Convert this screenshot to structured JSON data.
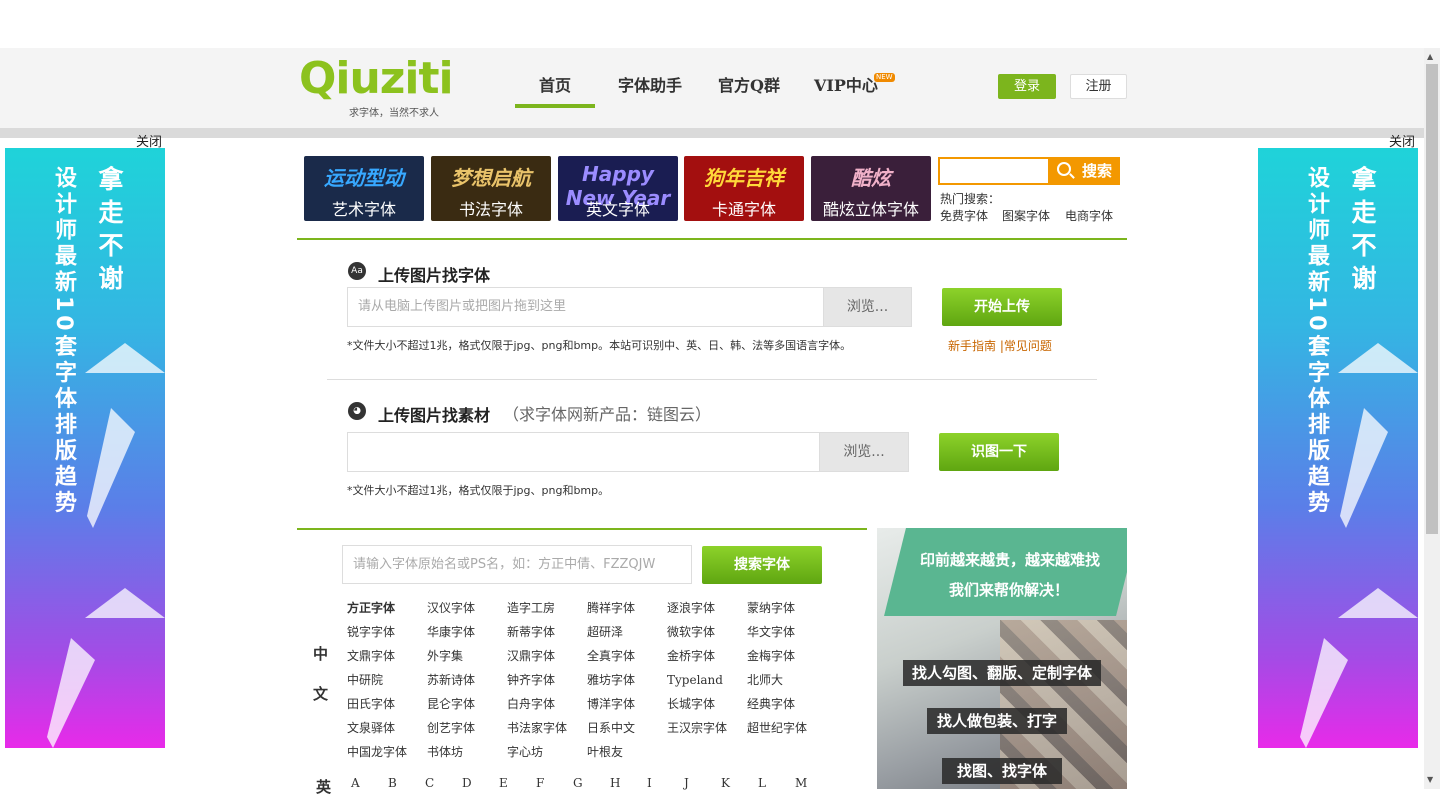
{
  "header": {
    "logo_text": "Qiuziti",
    "logo_tagline": "求字体，当然不求人",
    "nav": [
      "首页",
      "字体助手",
      "官方Q群",
      "VIP中心"
    ],
    "new_badge": "NEW",
    "login": "登录",
    "register": "注册"
  },
  "ads": {
    "close_label": "关闭",
    "col1": "拿走不谢",
    "col2": "设计师最新10套字体排版趋势"
  },
  "categories": [
    {
      "art": "运动型动",
      "label": "艺术字体",
      "bg": "#1a2a4a",
      "color": "#37a8ff"
    },
    {
      "art": "梦想启航",
      "label": "书法字体",
      "bg": "#3a2b12",
      "color": "#e9c36a"
    },
    {
      "art": "Happy New Year",
      "label": "英文字体",
      "bg": "#1a1d52",
      "color": "#9b8cff"
    },
    {
      "art": "狗年吉祥",
      "label": "卡通字体",
      "bg": "#a30f0f",
      "color": "#ffd83a"
    },
    {
      "art": "酷炫",
      "label": "酷炫立体字体",
      "bg": "#3a1f3a",
      "color": "#f0b0c8"
    }
  ],
  "search": {
    "placeholder": "",
    "button": "搜索",
    "hot_title": "热门搜索：",
    "hot": [
      "免费字体",
      "图案字体",
      "电商字体"
    ]
  },
  "upload_font": {
    "icon": "Aa",
    "title": "上传图片找字体",
    "placeholder": "请从电脑上传图片或把图片拖到这里",
    "browse": "浏览...",
    "button": "开始上传",
    "hint": "*文件大小不超过1兆，格式仅限于jpg、png和bmp。本站可识别中、英、日、韩、法等多国语言字体。",
    "help": "新手指南 |常见问题"
  },
  "upload_material": {
    "title": "上传图片找素材",
    "subtitle": "（求字体网新产品：链图云）",
    "placeholder": "",
    "browse": "浏览...",
    "button": "识图一下",
    "hint": "*文件大小不超过1兆，格式仅限于jpg、png和bmp。"
  },
  "font_search": {
    "placeholder": "请输入字体原始名或PS名，如：方正中倩、FZZQJW",
    "button": "搜索字体",
    "zh_label": "中文",
    "brands": [
      "方正字体",
      "汉仪字体",
      "造字工房",
      "腾祥字体",
      "逐浪字体",
      "蒙纳字体",
      "锐字字体",
      "华康字体",
      "新蒂字体",
      "超研泽",
      "微软字体",
      "华文字体",
      "文鼎字体",
      "外字集",
      "汉鼎字体",
      "全真字体",
      "金桥字体",
      "金梅字体",
      "中研院",
      "苏新诗体",
      "钟齐字体",
      "雅坊字体",
      "Typeland",
      "北师大",
      "田氏字体",
      "昆仑字体",
      "白舟字体",
      "博洋字体",
      "长城字体",
      "经典字体",
      "文泉驿体",
      "创艺字体",
      "书法家字体",
      "日系中文",
      "王汉宗字体",
      "超世纪字体",
      "中国龙字体",
      "书体坊",
      "字心坊",
      "叶根友"
    ],
    "en_label": "英",
    "letters": [
      "A",
      "B",
      "C",
      "D",
      "E",
      "F",
      "G",
      "H",
      "I",
      "J",
      "K",
      "L",
      "M"
    ]
  },
  "promo": {
    "line1": "印前越来越贵，越来越难找",
    "line2": "我们来帮你解决！",
    "tags": [
      "找人勾图、翻版、定制字体",
      "找人做包装、打字",
      "找图、找字体"
    ]
  }
}
